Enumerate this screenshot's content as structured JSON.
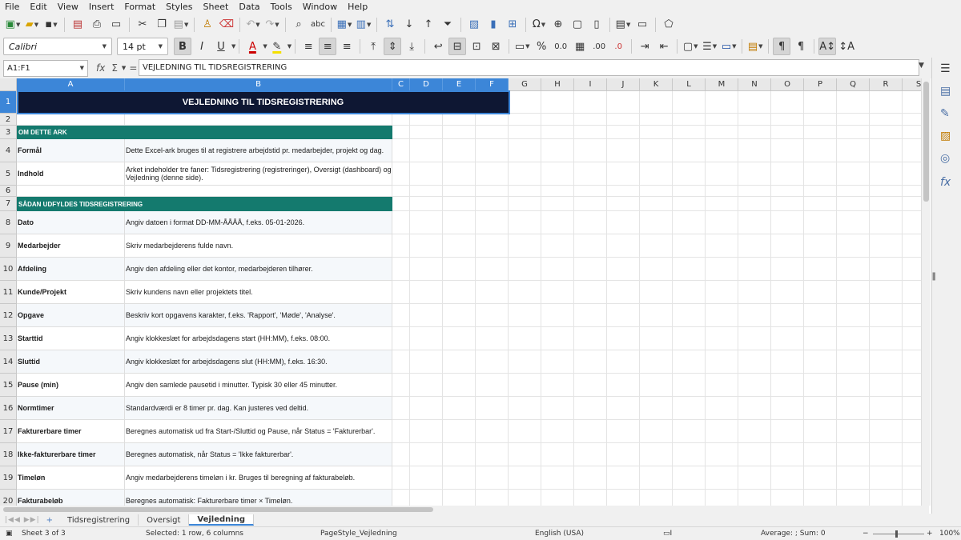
{
  "menu": [
    "File",
    "Edit",
    "View",
    "Insert",
    "Format",
    "Styles",
    "Sheet",
    "Data",
    "Tools",
    "Window",
    "Help"
  ],
  "toolbar": {
    "font_name": "Calibri",
    "font_size": "14 pt",
    "bold_label": "B",
    "italic_label": "I",
    "underline_label": "U",
    "percent_label": "%",
    "decimal_label": "0.0",
    "add_decimal_label": ".00",
    "remove_decimal_label": ".0"
  },
  "formula_bar": {
    "name_box": "A1:F1",
    "content": "VEJLEDNING TIL TIDSREGISTRERING",
    "fx": "fx",
    "sigma": "Σ",
    "equals": "="
  },
  "columns": [
    "A",
    "B",
    "C",
    "D",
    "E",
    "F",
    "G",
    "H",
    "I",
    "J",
    "K",
    "L",
    "M",
    "N",
    "O",
    "P",
    "Q",
    "R",
    "S"
  ],
  "rows": [
    "1",
    "2",
    "3",
    "4",
    "5",
    "6",
    "7",
    "8",
    "9",
    "10",
    "11",
    "12",
    "13",
    "14",
    "15",
    "16",
    "17",
    "18",
    "19",
    "20"
  ],
  "sheet": {
    "title": "VEJLEDNING TIL TIDSREGISTRERING",
    "section1": "OM DETTE ARK",
    "section2": "SÅDAN UDFYLDES TIDSREGISTRERING",
    "about": [
      {
        "label": "Formål",
        "desc": "Dette Excel-ark bruges til at registrere arbejdstid pr. medarbejder, projekt og dag."
      },
      {
        "label": "Indhold",
        "desc": "Arket indeholder tre faner: Tidsregistrering (registreringer), Oversigt (dashboard) og Vejledning (denne side)."
      }
    ],
    "fields": [
      {
        "label": "Dato",
        "desc": "Angiv datoen i format DD-MM-ÅÅÅÅ, f.eks. 05-01-2026."
      },
      {
        "label": "Medarbejder",
        "desc": "Skriv medarbejderens fulde navn."
      },
      {
        "label": "Afdeling",
        "desc": "Angiv den afdeling eller det kontor, medarbejderen tilhører."
      },
      {
        "label": "Kunde/Projekt",
        "desc": "Skriv kundens navn eller projektets titel."
      },
      {
        "label": "Opgave",
        "desc": "Beskriv kort opgavens karakter, f.eks. 'Rapport', 'Møde', 'Analyse'."
      },
      {
        "label": "Starttid",
        "desc": "Angiv klokkeslæt for arbejdsdagens start (HH:MM), f.eks. 08:00."
      },
      {
        "label": "Sluttid",
        "desc": "Angiv klokkeslæt for arbejdsdagens slut (HH:MM), f.eks. 16:30."
      },
      {
        "label": "Pause (min)",
        "desc": "Angiv den samlede pausetid i minutter. Typisk 30 eller 45 minutter."
      },
      {
        "label": "Normtimer",
        "desc": "Standardværdi er 8 timer pr. dag. Kan justeres ved deltid."
      },
      {
        "label": "Fakturerbare timer",
        "desc": "Beregnes automatisk ud fra Start-/Sluttid og Pause, når Status = 'Fakturerbar'."
      },
      {
        "label": "Ikke-fakturerbare timer",
        "desc": "Beregnes automatisk, når Status = 'Ikke fakturerbar'."
      },
      {
        "label": "Timeløn",
        "desc": "Angiv medarbejderens timeløn i kr. Bruges til beregning af fakturabeløb."
      },
      {
        "label": "Fakturabeløb",
        "desc": "Beregnes automatisk: Fakturerbare timer × Timeløn."
      }
    ]
  },
  "tabs": [
    "Tidsregistrering",
    "Oversigt",
    "Vejledning"
  ],
  "active_tab": "Vejledning",
  "status": {
    "sheet": "Sheet 3 of 3",
    "selection": "Selected: 1 row, 6 columns",
    "page_style": "PageStyle_Vejledning",
    "language": "English (USA)",
    "summary": "Average: ; Sum: 0",
    "zoom": "100%",
    "zoom_minus": "−",
    "zoom_plus": "+"
  },
  "colors": {
    "title_bg": "#0e1733",
    "section_bg": "#147a6e",
    "selection": "#3c86d8"
  }
}
